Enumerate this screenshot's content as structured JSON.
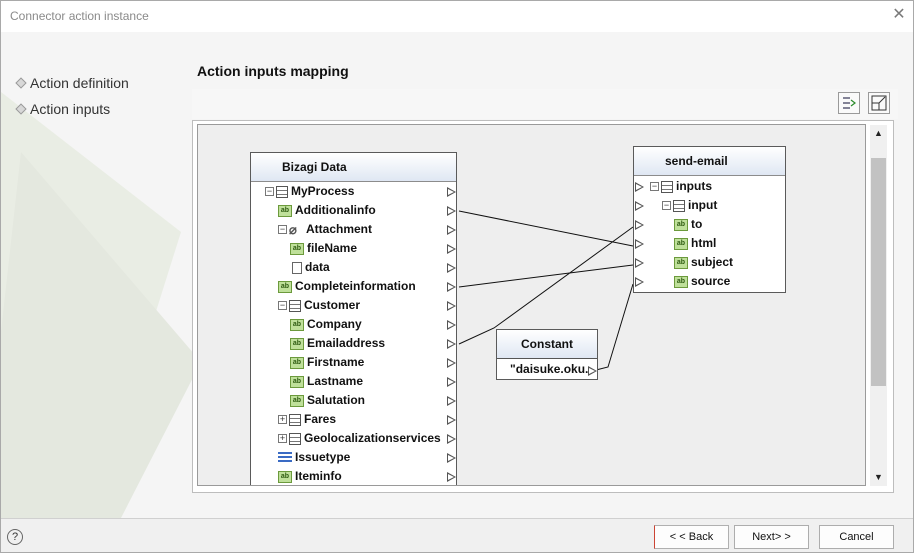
{
  "window": {
    "title": "Connector action instance"
  },
  "nav": {
    "items": [
      {
        "label": "Action definition"
      },
      {
        "label": "Action inputs"
      }
    ]
  },
  "page": {
    "heading": "Action inputs mapping"
  },
  "toolbar": {
    "icons": [
      "auto-map-icon",
      "fit-view-icon"
    ]
  },
  "source": {
    "title": "Bizagi Data",
    "rows": [
      {
        "label": "MyProcess",
        "icon": "table-icon"
      },
      {
        "label": "Additionalinfo",
        "icon": "text-field-icon"
      },
      {
        "label": "Attachment",
        "icon": "paperclip-icon"
      },
      {
        "label": "fileName",
        "icon": "text-field-icon"
      },
      {
        "label": "data",
        "icon": "document-icon"
      },
      {
        "label": "Completeinformation",
        "icon": "text-field-icon"
      },
      {
        "label": "Customer",
        "icon": "table-icon"
      },
      {
        "label": "Company",
        "icon": "text-field-icon"
      },
      {
        "label": "Emailaddress",
        "icon": "text-field-icon"
      },
      {
        "label": "Firstname",
        "icon": "text-field-icon"
      },
      {
        "label": "Lastname",
        "icon": "text-field-icon"
      },
      {
        "label": "Salutation",
        "icon": "text-field-icon"
      },
      {
        "label": "Fares",
        "icon": "table-icon"
      },
      {
        "label": "Geolocalizationservices",
        "icon": "table-icon"
      },
      {
        "label": "Issuetype",
        "icon": "list-icon"
      },
      {
        "label": "Iteminfo",
        "icon": "text-field-icon"
      }
    ]
  },
  "constant": {
    "title": "Constant",
    "value": "\"daisuke.oku."
  },
  "target": {
    "title": "send-email",
    "rows": [
      {
        "label": "inputs",
        "icon": "table-icon"
      },
      {
        "label": "input",
        "icon": "table-icon"
      },
      {
        "label": "to",
        "icon": "text-field-icon"
      },
      {
        "label": "html",
        "icon": "text-field-icon"
      },
      {
        "label": "subject",
        "icon": "text-field-icon"
      },
      {
        "label": "source",
        "icon": "text-field-icon"
      }
    ]
  },
  "footer": {
    "help": "?",
    "back": "< < Back",
    "next": "Next> >",
    "cancel": "Cancel"
  }
}
